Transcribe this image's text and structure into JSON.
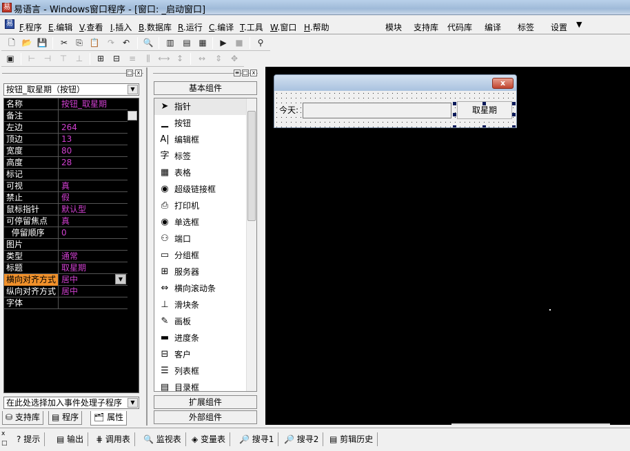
{
  "window": {
    "title": "易语言 - Windows窗口程序 - [窗口: _启动窗口]"
  },
  "menu": [
    {
      "key": "F",
      "label": ".程序"
    },
    {
      "key": "E",
      "label": ".编辑"
    },
    {
      "key": "V",
      "label": ".查看"
    },
    {
      "key": "I",
      "label": ".插入"
    },
    {
      "key": "B",
      "label": ".数据库"
    },
    {
      "key": "R",
      "label": ".运行"
    },
    {
      "key": "C",
      "label": ".编译"
    },
    {
      "key": "T",
      "label": ".工具"
    },
    {
      "key": "W",
      "label": ".窗口"
    },
    {
      "key": "H",
      "label": ".帮助"
    }
  ],
  "quickmenu": [
    "模块",
    "支持库",
    "代码库",
    "编译",
    "标签",
    "设置"
  ],
  "properties": {
    "selected_object": "按钮_取星期（按钮）",
    "rows": [
      {
        "k": "名称",
        "v": "按钮_取星期"
      },
      {
        "k": "备注",
        "v": ""
      },
      {
        "k": "左边",
        "v": "264"
      },
      {
        "k": "顶边",
        "v": "13"
      },
      {
        "k": "宽度",
        "v": "80"
      },
      {
        "k": "高度",
        "v": "28"
      },
      {
        "k": "标记",
        "v": ""
      },
      {
        "k": "可视",
        "v": "真"
      },
      {
        "k": "禁止",
        "v": "假"
      },
      {
        "k": "鼠标指针",
        "v": "默认型"
      },
      {
        "k": "可停留焦点",
        "v": "真"
      },
      {
        "k": "  停留顺序",
        "v": "0"
      },
      {
        "k": "图片",
        "v": ""
      },
      {
        "k": "类型",
        "v": "通常"
      },
      {
        "k": "标题",
        "v": "取星期"
      },
      {
        "k": "横向对齐方式",
        "v": "居中"
      },
      {
        "k": "纵向对齐方式",
        "v": "居中"
      },
      {
        "k": "字体",
        "v": ""
      }
    ],
    "event_combo": "在此处选择加入事件处理子程序",
    "tabs": [
      "支持库",
      "程序",
      "属性"
    ]
  },
  "components": {
    "basic_label": "基本组件",
    "items": [
      {
        "icon": "➤",
        "label": "指针"
      },
      {
        "icon": "▁",
        "label": "按钮"
      },
      {
        "icon": "A|",
        "label": "编辑框"
      },
      {
        "icon": "字",
        "label": "标签"
      },
      {
        "icon": "▦",
        "label": "表格"
      },
      {
        "icon": "◉",
        "label": "超级链接框"
      },
      {
        "icon": "⎙",
        "label": "打印机"
      },
      {
        "icon": "◉",
        "label": "单选框"
      },
      {
        "icon": "⚇",
        "label": "端口"
      },
      {
        "icon": "▭",
        "label": "分组框"
      },
      {
        "icon": "⊞",
        "label": "服务器"
      },
      {
        "icon": "⇔",
        "label": "横向滚动条"
      },
      {
        "icon": "⊥",
        "label": "滑块条"
      },
      {
        "icon": "✎",
        "label": "画板"
      },
      {
        "icon": "▬",
        "label": "进度条"
      },
      {
        "icon": "⊟",
        "label": "客户"
      },
      {
        "icon": "☰",
        "label": "列表框"
      },
      {
        "icon": "▤",
        "label": "目录框"
      }
    ],
    "extended_label": "扩展组件",
    "external_label": "外部组件"
  },
  "form": {
    "label": "今天:",
    "button": "取星期",
    "close": "x"
  },
  "bottom_tabs": [
    "提示",
    "输出",
    "调用表",
    "监视表",
    "变量表",
    "搜寻1",
    "搜寻2",
    "剪辑历史"
  ],
  "colors": {
    "grid_bg": "#000000",
    "value": "#d040d0",
    "selected_key": "#f0902a"
  }
}
